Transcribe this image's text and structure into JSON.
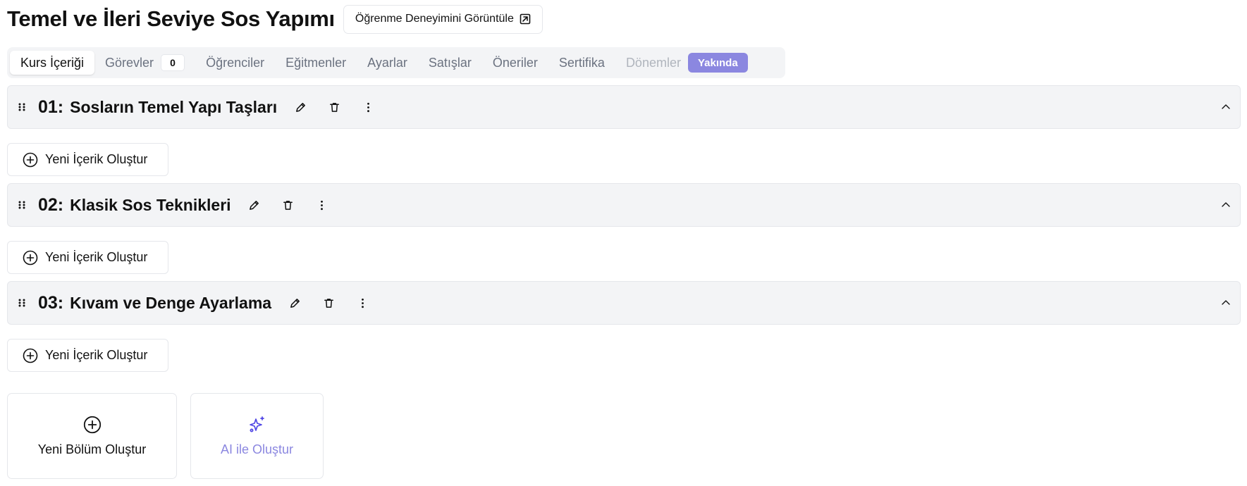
{
  "header": {
    "title": "Temel ve İleri Seviye Sos Yapımı",
    "view_button": "Öğrenme Deneyimini Görüntüle"
  },
  "tabs": [
    {
      "label": "Kurs İçeriği",
      "active": true
    },
    {
      "label": "Görevler",
      "count": "0"
    },
    {
      "label": "Öğrenciler"
    },
    {
      "label": "Eğitmenler"
    },
    {
      "label": "Ayarlar"
    },
    {
      "label": "Satışlar"
    },
    {
      "label": "Öneriler"
    },
    {
      "label": "Sertifika"
    },
    {
      "label": "Dönemler",
      "disabled": true,
      "badge": "Yakında"
    }
  ],
  "sections": [
    {
      "number": "01:",
      "title": "Sosların Temel Yapı Taşları"
    },
    {
      "number": "02:",
      "title": "Klasik Sos Teknikleri"
    },
    {
      "number": "03:",
      "title": "Kıvam ve Denge Ayarlama"
    }
  ],
  "new_content_label": "Yeni İçerik Oluştur",
  "cards": {
    "new_section": "Yeni Bölüm Oluştur",
    "ai_create": "AI ile Oluştur"
  },
  "colors": {
    "accent": "#8b87e0",
    "ai_icon": "#4f46e5",
    "section_bg": "#f3f4f6"
  },
  "icons": {
    "view_button": "external-link-icon",
    "drag": "drag-handle-icon",
    "edit": "pencil-icon",
    "delete": "trash-icon",
    "more": "more-vertical-icon",
    "collapse": "chevron-up-icon",
    "add": "plus-circle-icon",
    "ai": "sparkles-icon"
  }
}
